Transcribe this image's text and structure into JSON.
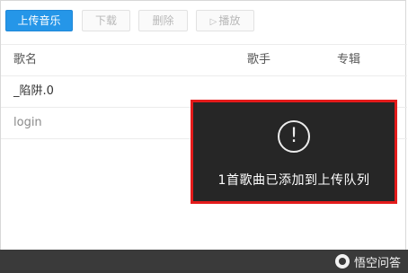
{
  "toolbar": {
    "upload_label": "上传音乐",
    "download_label": "下载",
    "delete_label": "删除",
    "play_label": "播放",
    "play_icon": "play-icon"
  },
  "table": {
    "headers": {
      "name": "歌名",
      "artist": "歌手",
      "album": "专辑"
    },
    "rows": [
      {
        "name": "_陷阱.0",
        "artist": "",
        "album": ""
      },
      {
        "name": "login",
        "artist": "",
        "album": ""
      }
    ]
  },
  "toast": {
    "icon": "exclamation-circle-icon",
    "message": "1首歌曲已添加到上传队列",
    "border_color": "#e31b1b"
  },
  "watermark": {
    "text": "悟空问答"
  },
  "colors": {
    "primary": "#2596e8",
    "toast_bg": "#262626",
    "bottom_bar": "#3a3a3a"
  }
}
